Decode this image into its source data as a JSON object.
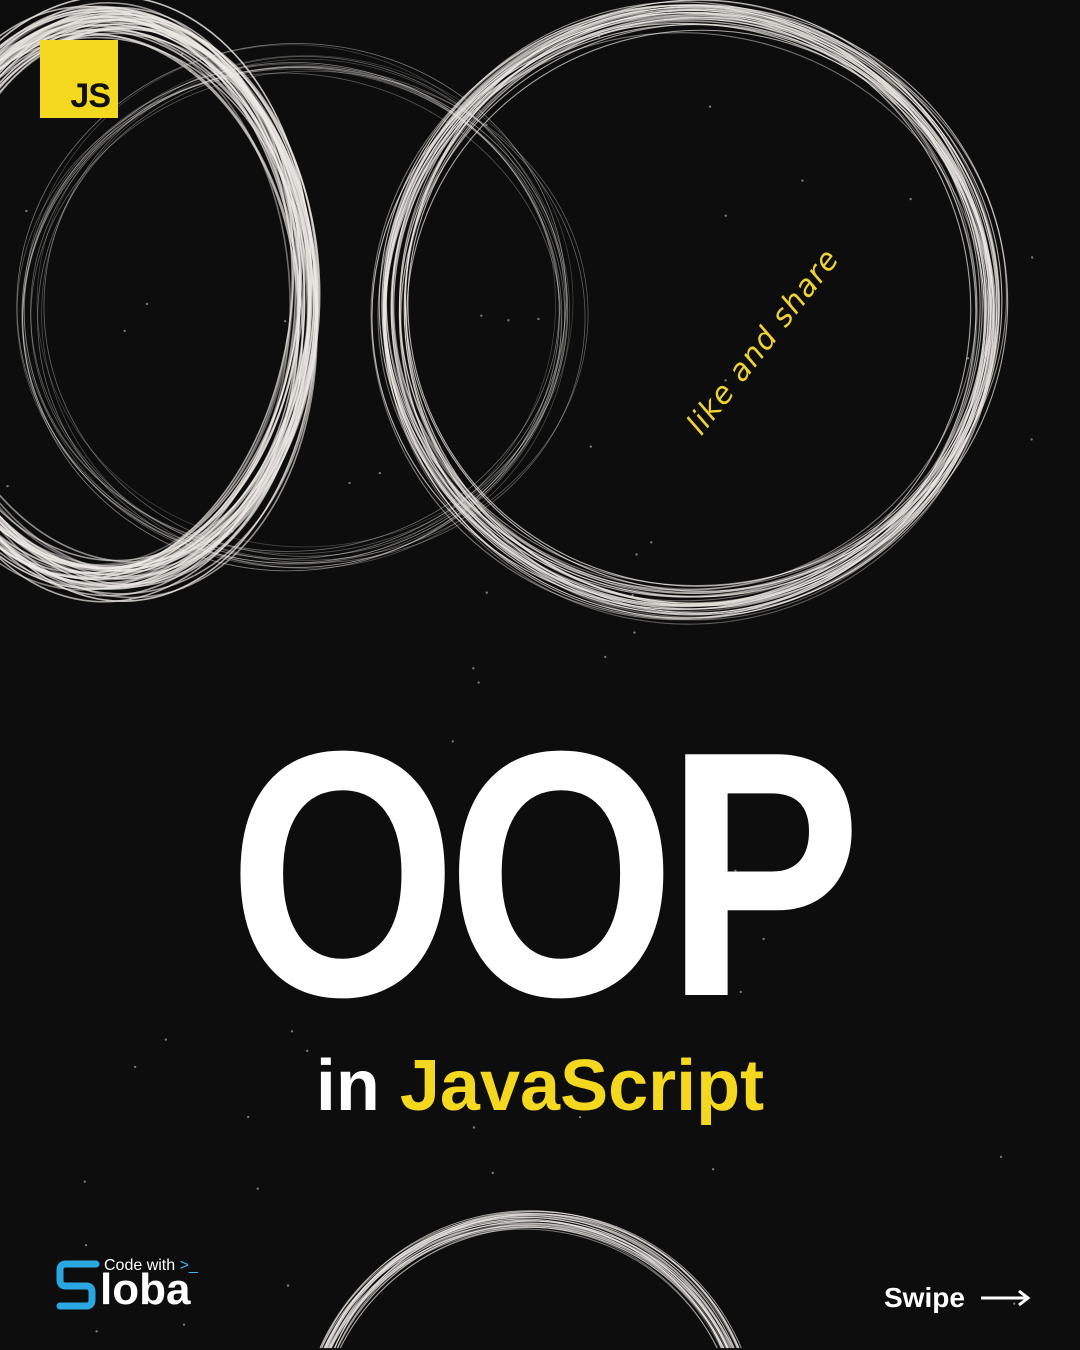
{
  "badge": {
    "label": "JS",
    "color": "#f3d81f"
  },
  "decor": {
    "tagline": "like and share"
  },
  "headline": {
    "title": "OOP",
    "prefix": "in",
    "accent": "JavaScript",
    "accent_color": "#f3d81f"
  },
  "brand": {
    "top": "Code with",
    "prompt": ">_",
    "name": "loba"
  },
  "nav": {
    "swipe": "Swipe",
    "icon": "arrow-right-icon"
  }
}
